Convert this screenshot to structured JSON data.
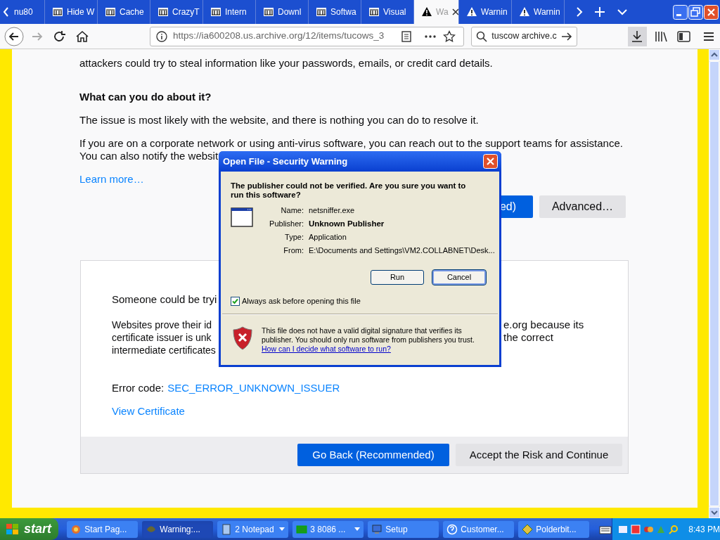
{
  "tabs": [
    {
      "label": "nu80",
      "kind": "plain",
      "selected": false
    },
    {
      "label": "Hide W",
      "kind": "archive",
      "selected": false
    },
    {
      "label": "Cache",
      "kind": "archive",
      "selected": false
    },
    {
      "label": "CrazyT",
      "kind": "archive",
      "selected": false
    },
    {
      "label": "Intern",
      "kind": "archive",
      "selected": false
    },
    {
      "label": "Downl",
      "kind": "archive",
      "selected": false
    },
    {
      "label": "Softwa",
      "kind": "archive",
      "selected": false
    },
    {
      "label": "Visual",
      "kind": "archive",
      "selected": false
    },
    {
      "label": "Wa",
      "kind": "warning",
      "selected": true
    },
    {
      "label": "Warnin",
      "kind": "warning",
      "selected": false
    },
    {
      "label": "Warnin",
      "kind": "warning",
      "selected": false
    }
  ],
  "toolbar": {
    "url": "https://ia600208.us.archive.org/12/items/tucows_3",
    "search": "tuscow archive.c"
  },
  "page": {
    "intro": "attackers could try to steal information like your passwords, emails, or credit card details.",
    "heading": "What can you do about it?",
    "p1": "The issue is most likely with the website, and there is nothing you can do to resolve it.",
    "p2_line1": "If you are on a corporate network or using anti-virus software, you can reach out to the support teams for assistance.",
    "p2_line2": "You can also notify the websit",
    "learn_more": "Learn more…",
    "button_partial": "ed)",
    "advanced": "Advanced…",
    "card": {
      "someone": "Someone could be tryi",
      "websites_left": [
        "Websites prove their id",
        "certificate issuer is unk",
        "intermediate certificates"
      ],
      "websites_right": [
        "e.org because its",
        "the correct"
      ],
      "error_label": "Error code:",
      "error_code": "SEC_ERROR_UNKNOWN_ISSUER",
      "view_certificate": "View Certificate",
      "go_back": "Go Back (Recommended)",
      "accept": "Accept the Risk and Continue"
    }
  },
  "dialog": {
    "title": "Open File - Security Warning",
    "question": "The publisher could not be verified.  Are you sure you want to run this software?",
    "fields": [
      {
        "label": "Name:",
        "value": "netsniffer.exe",
        "bold": false
      },
      {
        "label": "Publisher:",
        "value": "Unknown Publisher",
        "bold": true
      },
      {
        "label": "Type:",
        "value": "Application",
        "bold": false
      },
      {
        "label": "From:",
        "value": "E:\\Documents and Settings\\VM2.COLLABNET\\Desk...",
        "bold": false
      }
    ],
    "run": "Run",
    "cancel": "Cancel",
    "always_ask": {
      "label": "Always ask before opening this file",
      "checked": true
    },
    "warning_text": "This file does not have a valid digital signature that verifies its publisher.  You should only run software from publishers you trust.",
    "help_link": "How can I decide what software to run?"
  },
  "taskbar": {
    "start": "start",
    "items": [
      {
        "label": "Start Pag...",
        "menu": false,
        "selected": false
      },
      {
        "label": "Warning:...",
        "menu": false,
        "selected": true
      },
      {
        "label": "2 Notepad",
        "menu": true,
        "selected": false
      },
      {
        "label": "3 8086 ...",
        "menu": true,
        "selected": false
      },
      {
        "label": "Setup",
        "menu": false,
        "selected": false
      },
      {
        "label": "Customer...",
        "menu": false,
        "selected": false
      },
      {
        "label": "Polderbit...",
        "menu": false,
        "selected": false
      }
    ],
    "clock": "8:43 PM"
  }
}
